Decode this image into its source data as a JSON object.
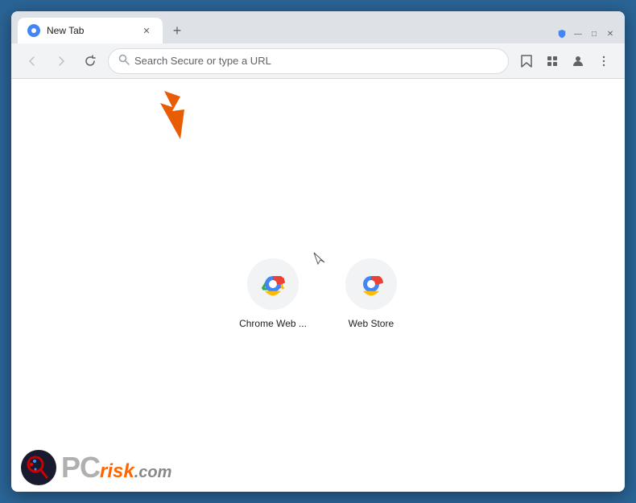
{
  "window": {
    "title": "New Tab",
    "controls": {
      "minimize": "—",
      "maximize": "□",
      "close": "✕"
    }
  },
  "tabs": [
    {
      "label": "New Tab",
      "active": true
    }
  ],
  "new_tab_btn": "+",
  "nav": {
    "back_title": "Back",
    "forward_title": "Forward",
    "refresh_title": "Reload",
    "address_placeholder": "Search Secure or type a URL"
  },
  "nav_icons": {
    "bookmark": "☆",
    "extension": "🧩",
    "profile": "👤",
    "menu": "⋮"
  },
  "shortcuts": [
    {
      "label": "Chrome Web ...",
      "aria": "Chrome Web Store shortcut"
    },
    {
      "label": "Web Store",
      "aria": "Web Store shortcut"
    }
  ],
  "watermark": {
    "brand": "PC",
    "suffix": "risk",
    "tld": ".com"
  },
  "colors": {
    "accent_orange": "#ff6600",
    "arrow_orange": "#e85d04",
    "browser_border": "#2a6496",
    "tab_bg": "#dee1e6",
    "active_tab_bg": "#ffffff"
  }
}
